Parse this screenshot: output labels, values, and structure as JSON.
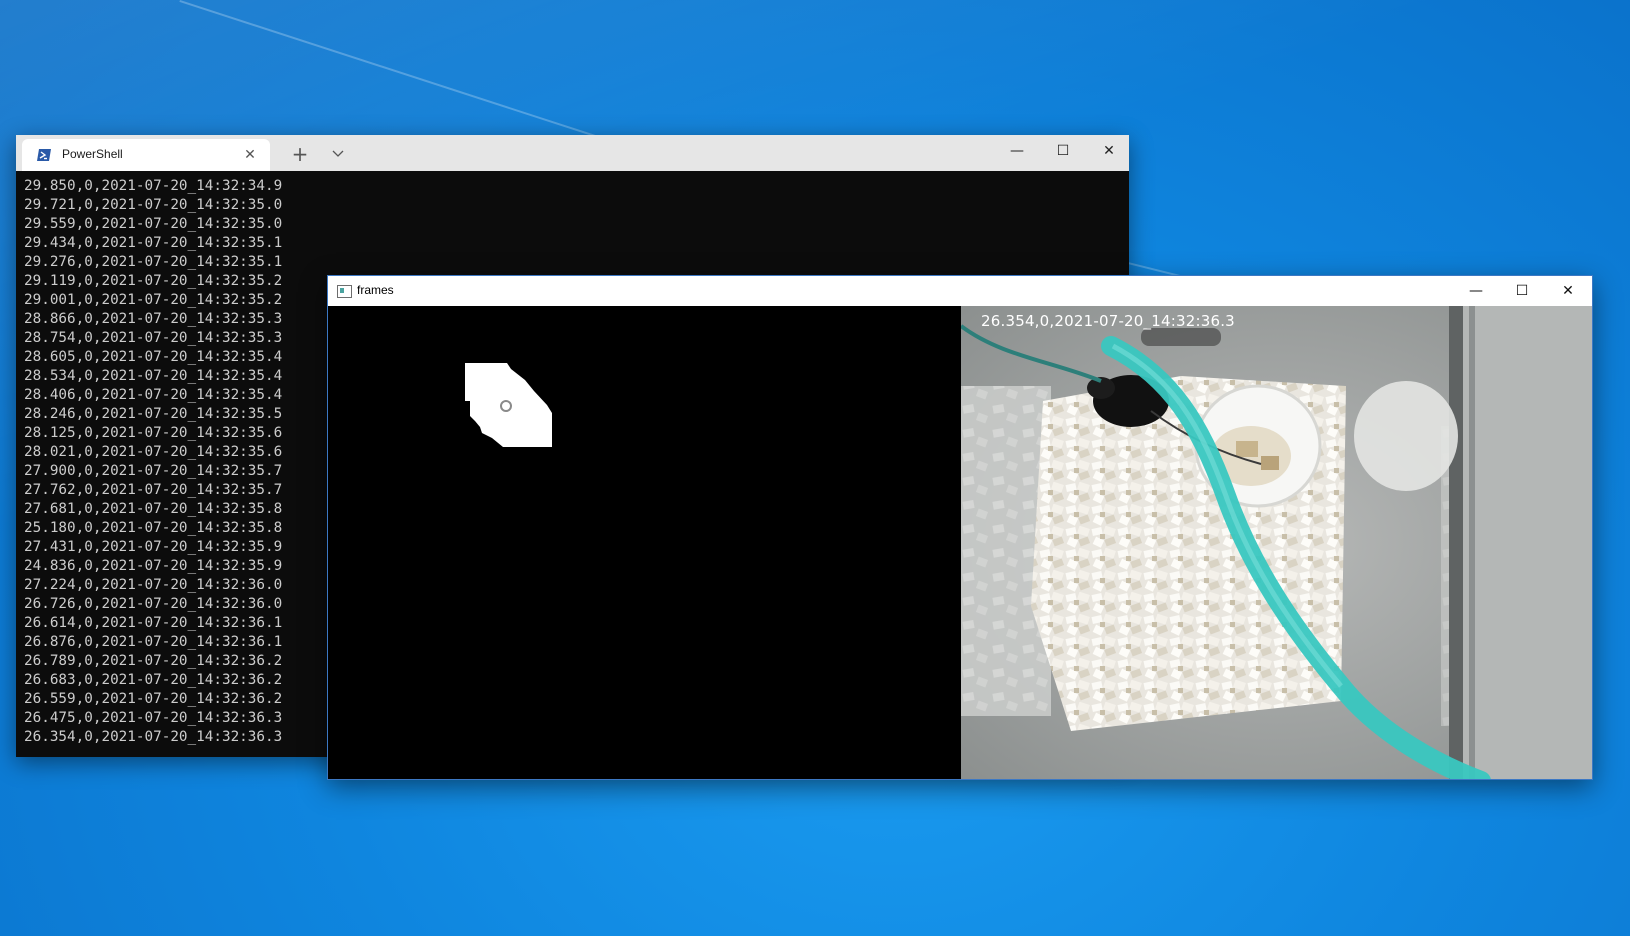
{
  "powershell": {
    "tab_title": "PowerShell",
    "tab_close_icon": "close-icon",
    "new_tab_icon": "plus-icon",
    "dropdown_icon": "chevron-down-icon",
    "controls": {
      "minimize": "—",
      "maximize": "☐",
      "close": "✕"
    },
    "lines": [
      "29.850,0,2021-07-20_14:32:34.9",
      "29.721,0,2021-07-20_14:32:35.0",
      "29.559,0,2021-07-20_14:32:35.0",
      "29.434,0,2021-07-20_14:32:35.1",
      "29.276,0,2021-07-20_14:32:35.1",
      "29.119,0,2021-07-20_14:32:35.2",
      "29.001,0,2021-07-20_14:32:35.2",
      "28.866,0,2021-07-20_14:32:35.3",
      "28.754,0,2021-07-20_14:32:35.3",
      "28.605,0,2021-07-20_14:32:35.4",
      "28.534,0,2021-07-20_14:32:35.4",
      "28.406,0,2021-07-20_14:32:35.4",
      "28.246,0,2021-07-20_14:32:35.5",
      "28.125,0,2021-07-20_14:32:35.6",
      "28.021,0,2021-07-20_14:32:35.6",
      "27.900,0,2021-07-20_14:32:35.7",
      "27.762,0,2021-07-20_14:32:35.7",
      "27.681,0,2021-07-20_14:32:35.8",
      "25.180,0,2021-07-20_14:32:35.8",
      "27.431,0,2021-07-20_14:32:35.9",
      "24.836,0,2021-07-20_14:32:35.9",
      "27.224,0,2021-07-20_14:32:36.0",
      "26.726,0,2021-07-20_14:32:36.0",
      "26.614,0,2021-07-20_14:32:36.1",
      "26.876,0,2021-07-20_14:32:36.1",
      "26.789,0,2021-07-20_14:32:36.2",
      "26.683,0,2021-07-20_14:32:36.2",
      "26.559,0,2021-07-20_14:32:36.2",
      "26.475,0,2021-07-20_14:32:36.3",
      "26.354,0,2021-07-20_14:32:36.3"
    ]
  },
  "frames": {
    "title": "frames",
    "controls": {
      "minimize": "—",
      "maximize": "☐",
      "close": "✕"
    },
    "overlay_text": "26.354,0,2021-07-20_14:32:36.3"
  },
  "colors": {
    "desktop": "#0d80da",
    "terminal_bg": "#0c0c0c",
    "terminal_text": "#cccccc",
    "tether": "#39c7c0"
  }
}
